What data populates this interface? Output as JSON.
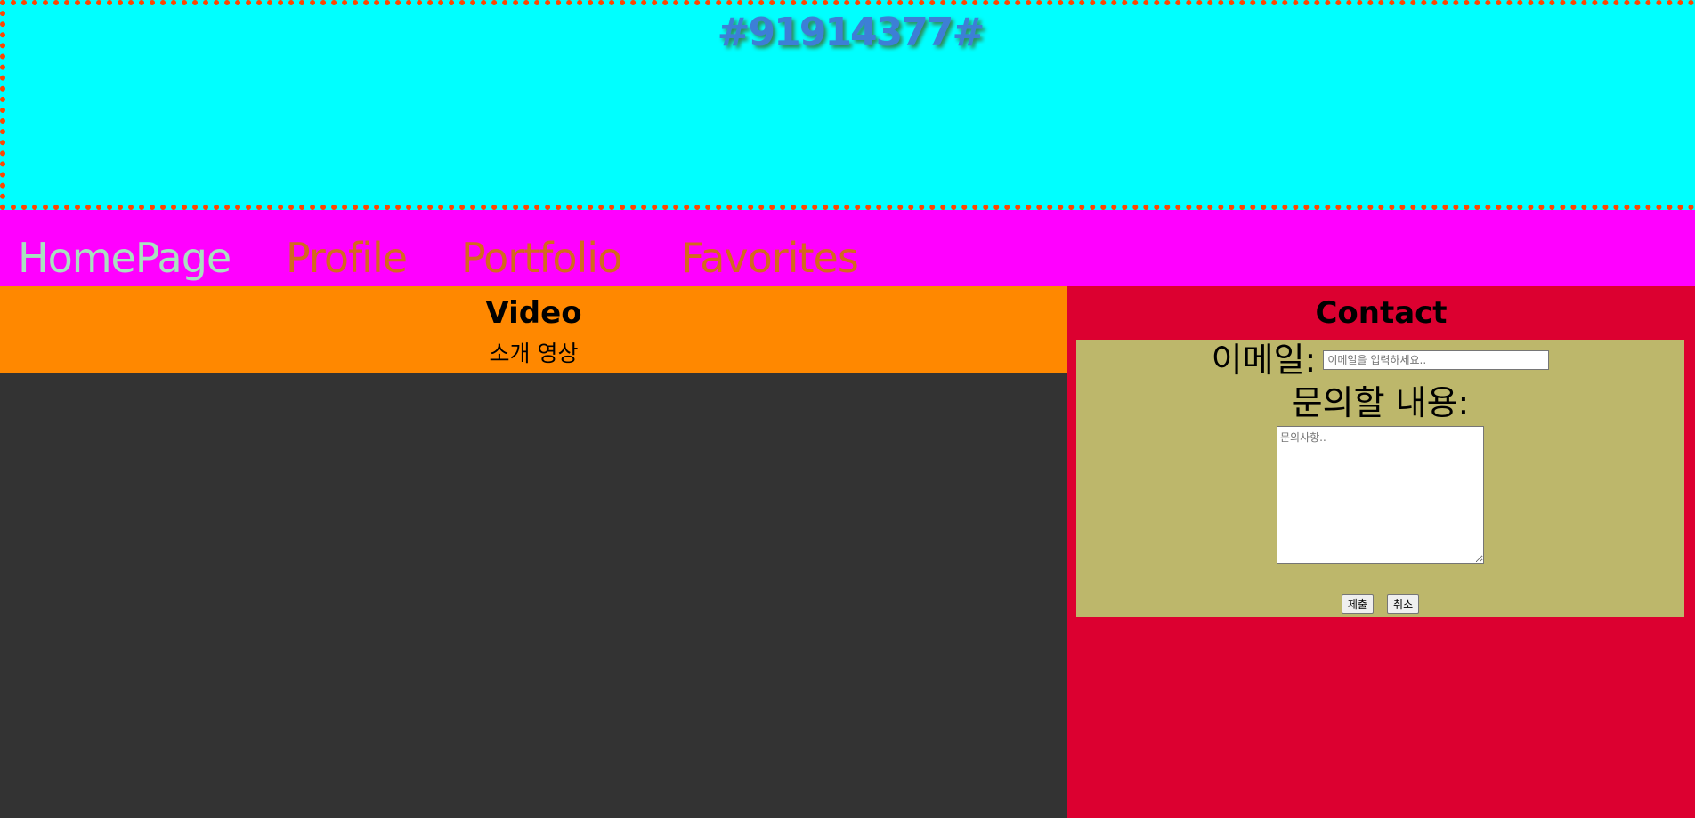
{
  "header": {
    "title": "#91914377#"
  },
  "nav": {
    "items": [
      {
        "label": "HomePage"
      },
      {
        "label": "Profile"
      },
      {
        "label": "Portfolio"
      },
      {
        "label": "Favorites"
      }
    ]
  },
  "video": {
    "title": "Video",
    "subtitle": "소개 영상"
  },
  "contact": {
    "title": "Contact",
    "email_label": "이메일:",
    "email_placeholder": "이메일을 입력하세요..",
    "email_value": "",
    "message_label": "문의할 내용:",
    "message_placeholder": "문의사항..",
    "message_value": "",
    "submit_label": "제출",
    "cancel_label": "취소"
  },
  "colors": {
    "header_bg": "#00ffff",
    "header_border": "#ff4500",
    "nav_bg": "#ff00ff",
    "nav_active": "#a9e0c0",
    "nav_link": "#d2691e",
    "video_header_bg": "#ff8800",
    "video_bg": "#333333",
    "contact_bg": "#dc0030",
    "form_bg": "#bdb76b"
  }
}
